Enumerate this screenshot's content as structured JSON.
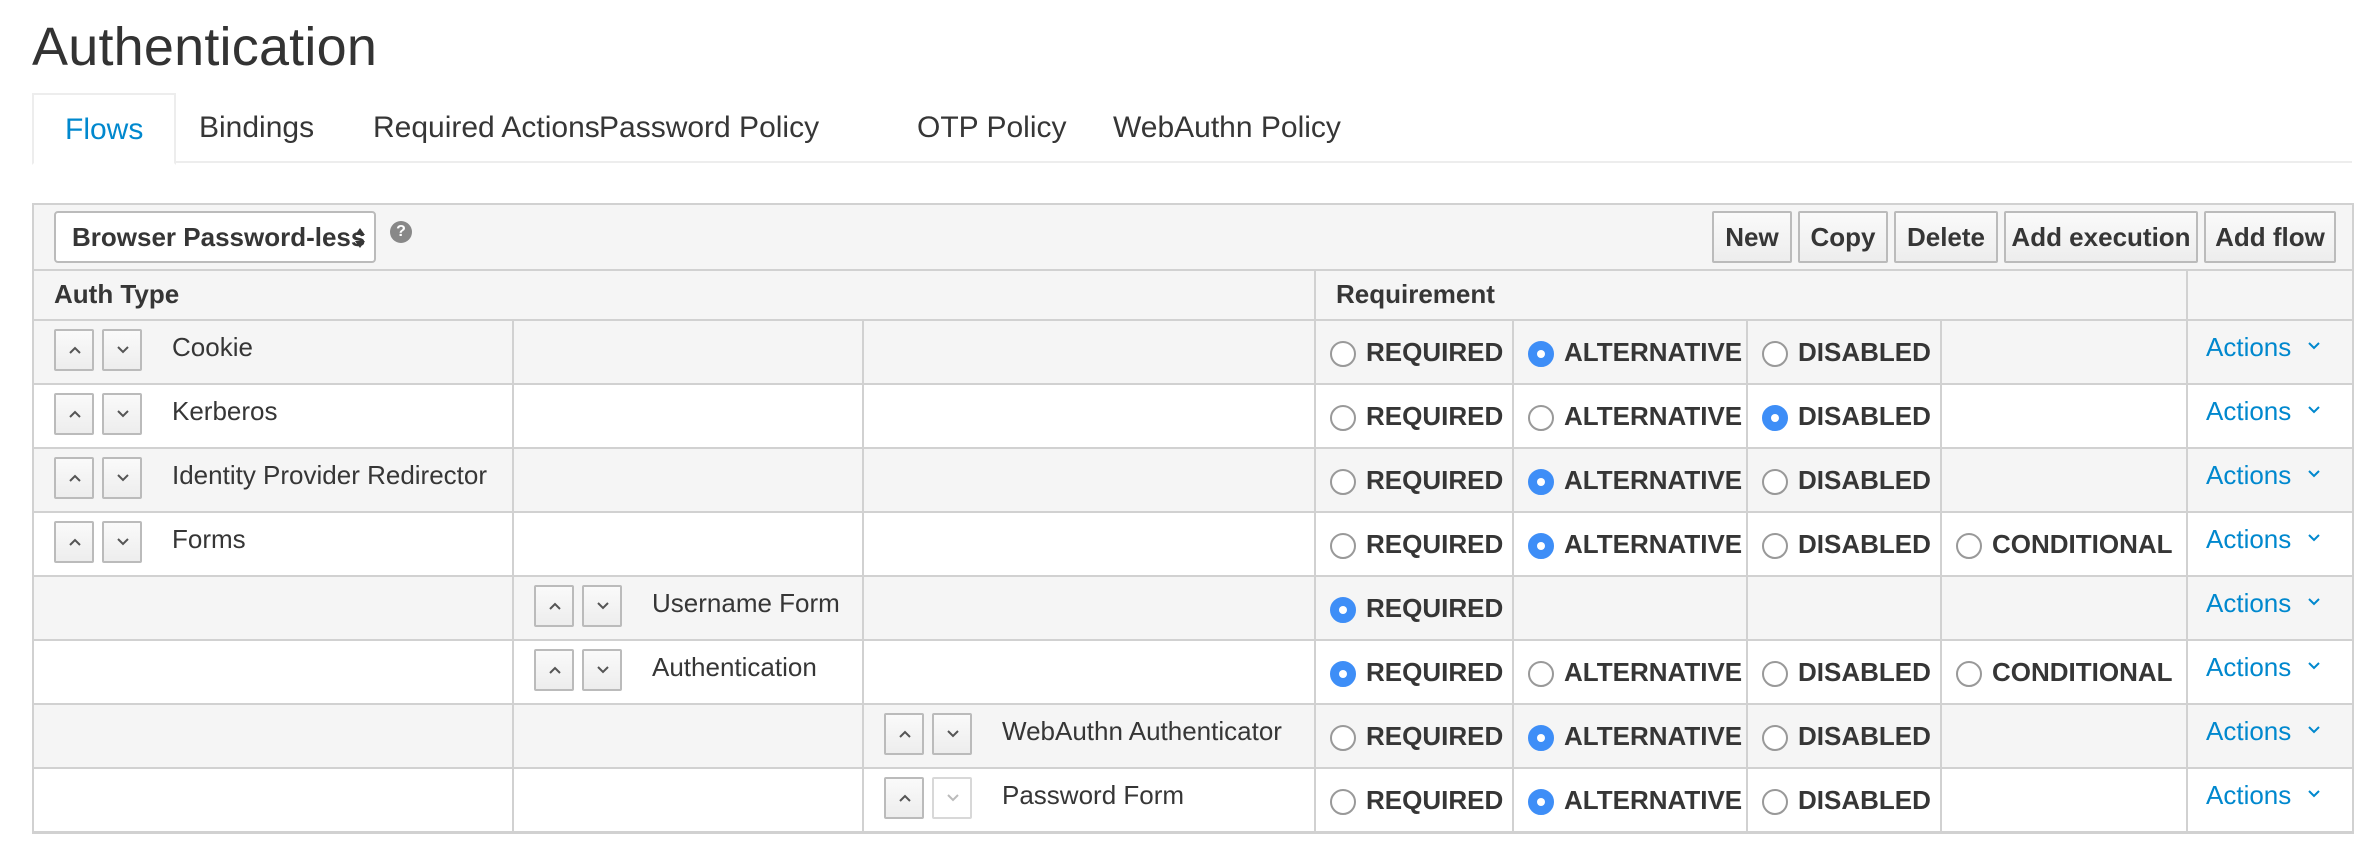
{
  "page": {
    "title": "Authentication"
  },
  "tabs": [
    {
      "label": "Flows",
      "active": true
    },
    {
      "label": "Bindings"
    },
    {
      "label": "Required Actions"
    },
    {
      "label": "Password Policy"
    },
    {
      "label": "OTP Policy"
    },
    {
      "label": "WebAuthn Policy"
    }
  ],
  "toolbar": {
    "flow_select": "Browser Password-less",
    "help": "?",
    "buttons": {
      "new": "New",
      "copy": "Copy",
      "delete": "Delete",
      "add_execution": "Add execution",
      "add_flow": "Add flow"
    }
  },
  "table": {
    "headers": {
      "auth_type": "Auth Type",
      "requirement": "Requirement"
    },
    "actions_label": "Actions",
    "options": {
      "required": "REQUIRED",
      "alternative": "ALTERNATIVE",
      "disabled": "DISABLED",
      "conditional": "CONDITIONAL"
    },
    "rows": [
      {
        "name": "Cookie",
        "level": 0,
        "options": [
          "required",
          "alternative",
          "disabled"
        ],
        "selected": "alternative",
        "down_disabled": false
      },
      {
        "name": "Kerberos",
        "level": 0,
        "options": [
          "required",
          "alternative",
          "disabled"
        ],
        "selected": "disabled",
        "down_disabled": false
      },
      {
        "name": "Identity Provider Redirector",
        "level": 0,
        "options": [
          "required",
          "alternative",
          "disabled"
        ],
        "selected": "alternative",
        "down_disabled": false
      },
      {
        "name": "Forms",
        "level": 0,
        "options": [
          "required",
          "alternative",
          "disabled",
          "conditional"
        ],
        "selected": "alternative",
        "down_disabled": false
      },
      {
        "name": "Username Form",
        "level": 1,
        "options": [
          "required"
        ],
        "selected": "required",
        "down_disabled": false
      },
      {
        "name": "Authentication",
        "level": 1,
        "options": [
          "required",
          "alternative",
          "disabled",
          "conditional"
        ],
        "selected": "required",
        "down_disabled": false
      },
      {
        "name": "WebAuthn Authenticator",
        "level": 2,
        "options": [
          "required",
          "alternative",
          "disabled"
        ],
        "selected": "alternative",
        "down_disabled": false
      },
      {
        "name": "Password Form",
        "level": 2,
        "options": [
          "required",
          "alternative",
          "disabled"
        ],
        "selected": "alternative",
        "down_disabled": true
      }
    ]
  },
  "colors": {
    "accent": "#0088ce",
    "radio_checked": "#3e8ef7",
    "border": "#d1d1d1",
    "row_alt": "#f5f5f5"
  }
}
